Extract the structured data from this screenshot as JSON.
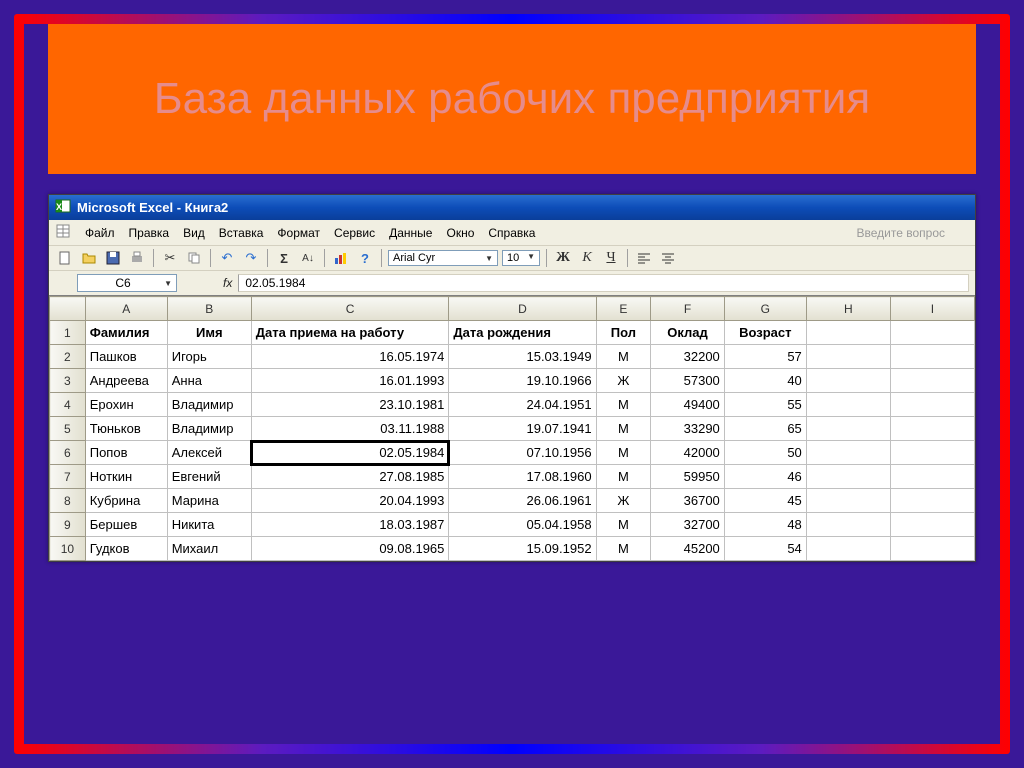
{
  "slide": {
    "title": "База данных рабочих предприятия"
  },
  "window": {
    "title": "Microsoft Excel - Книга2"
  },
  "menu": {
    "file": "Файл",
    "edit": "Правка",
    "view": "Вид",
    "insert": "Вставка",
    "format": "Формат",
    "tools": "Сервис",
    "data": "Данные",
    "window": "Окно",
    "help": "Справка",
    "search_placeholder": "Введите вопрос"
  },
  "toolbar": {
    "font_name": "Arial Cyr",
    "font_size": "10",
    "bold": "Ж",
    "italic": "К",
    "underline": "Ч"
  },
  "cellref": {
    "name": "C6",
    "fx": "fx",
    "value": "02.05.1984"
  },
  "columns": [
    "A",
    "B",
    "C",
    "D",
    "E",
    "F",
    "G",
    "H",
    "I"
  ],
  "headers": {
    "A": "Фамилия",
    "B": "Имя",
    "C": "Дата приема на работу",
    "D": "Дата рождения",
    "E": "Пол",
    "F": "Оклад",
    "G": "Возраст"
  },
  "rows": [
    {
      "n": "2",
      "A": "Пашков",
      "B": "Игорь",
      "C": "16.05.1974",
      "D": "15.03.1949",
      "E": "М",
      "F": "32200",
      "G": "57"
    },
    {
      "n": "3",
      "A": "Андреева",
      "B": "Анна",
      "C": "16.01.1993",
      "D": "19.10.1966",
      "E": "Ж",
      "F": "57300",
      "G": "40"
    },
    {
      "n": "4",
      "A": "Ерохин",
      "B": "Владимир",
      "C": "23.10.1981",
      "D": "24.04.1951",
      "E": "М",
      "F": "49400",
      "G": "55"
    },
    {
      "n": "5",
      "A": "Тюньков",
      "B": "Владимир",
      "C": "03.11.1988",
      "D": "19.07.1941",
      "E": "М",
      "F": "33290",
      "G": "65"
    },
    {
      "n": "6",
      "A": "Попов",
      "B": "Алексей",
      "C": "02.05.1984",
      "D": "07.10.1956",
      "E": "М",
      "F": "42000",
      "G": "50"
    },
    {
      "n": "7",
      "A": "Ноткин",
      "B": "Евгений",
      "C": "27.08.1985",
      "D": "17.08.1960",
      "E": "М",
      "F": "59950",
      "G": "46"
    },
    {
      "n": "8",
      "A": "Кубрина",
      "B": "Марина",
      "C": "20.04.1993",
      "D": "26.06.1961",
      "E": "Ж",
      "F": "36700",
      "G": "45"
    },
    {
      "n": "9",
      "A": "Бершев",
      "B": "Никита",
      "C": "18.03.1987",
      "D": "05.04.1958",
      "E": "М",
      "F": "32700",
      "G": "48"
    },
    {
      "n": "10",
      "A": "Гудков",
      "B": "Михаил",
      "C": "09.08.1965",
      "D": "15.09.1952",
      "E": "М",
      "F": "45200",
      "G": "54"
    }
  ],
  "active": {
    "row": 5,
    "col": "C"
  },
  "chart_data": {
    "type": "table",
    "title": "База данных рабочих предприятия",
    "columns": [
      "Фамилия",
      "Имя",
      "Дата приема на работу",
      "Дата рождения",
      "Пол",
      "Оклад",
      "Возраст"
    ],
    "rows": [
      [
        "Пашков",
        "Игорь",
        "16.05.1974",
        "15.03.1949",
        "М",
        32200,
        57
      ],
      [
        "Андреева",
        "Анна",
        "16.01.1993",
        "19.10.1966",
        "Ж",
        57300,
        40
      ],
      [
        "Ерохин",
        "Владимир",
        "23.10.1981",
        "24.04.1951",
        "М",
        49400,
        55
      ],
      [
        "Тюньков",
        "Владимир",
        "03.11.1988",
        "19.07.1941",
        "М",
        33290,
        65
      ],
      [
        "Попов",
        "Алексей",
        "02.05.1984",
        "07.10.1956",
        "М",
        42000,
        50
      ],
      [
        "Ноткин",
        "Евгений",
        "27.08.1985",
        "17.08.1960",
        "М",
        59950,
        46
      ],
      [
        "Кубрина",
        "Марина",
        "20.04.1993",
        "26.06.1961",
        "Ж",
        36700,
        45
      ],
      [
        "Бершев",
        "Никита",
        "18.03.1987",
        "05.04.1958",
        "М",
        32700,
        48
      ],
      [
        "Гудков",
        "Михаил",
        "09.08.1965",
        "15.09.1952",
        "М",
        45200,
        54
      ]
    ]
  }
}
